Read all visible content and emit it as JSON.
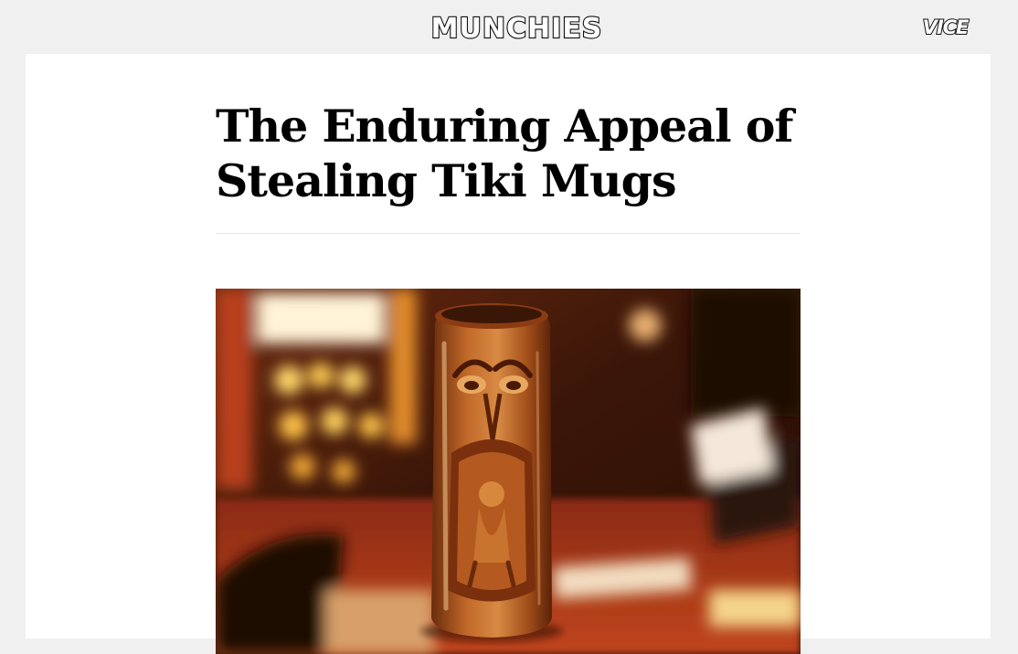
{
  "header": {
    "brand": "MUNCHIES",
    "network_logo": "VICE"
  },
  "article": {
    "title": "The Enduring Appeal of Stealing Tiki Mugs",
    "hero_image": {
      "icon": "tiki-mug-photo",
      "description_visible": false
    }
  },
  "colors": {
    "page_background": "#f0f0f0",
    "card_background": "#ffffff",
    "headline": "#000000",
    "rule": "#e6e6e6"
  }
}
